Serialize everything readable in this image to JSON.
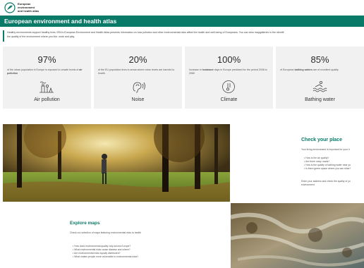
{
  "header": {
    "logo_text_lines": [
      "European",
      "environment",
      "and health atlas"
    ],
    "title": "European environment and health atlas"
  },
  "intro": {
    "line1": "Healthy environments support healthy lives. EEA's European Environment and Health Atlas presents information on how pollution and other environmental risks affect the health and well-being of Europeans. You can view mapgalleries in the identifi",
    "line2": "the quality of the environment where you live, work and play."
  },
  "stats": [
    {
      "percent": "97%",
      "description_pre": "of the urban population in Europe is exposed to unsafe levels of ",
      "description_bold": "air pollution",
      "description_post": "",
      "label": "Air pollution",
      "icon": "air-pollution-icon"
    },
    {
      "percent": "20%",
      "description_pre": "of the EU population lives in areas where noise levels are harmful to health",
      "description_bold": "",
      "description_post": "",
      "label": "Noise",
      "icon": "noise-ear-icon"
    },
    {
      "percent": "100%",
      "description_pre": "Increase in ",
      "description_bold": "heatwave",
      "description_post": " days in Europe predicted for the period 2036 to 2080",
      "label": "Climate",
      "icon": "thermometer-icon"
    },
    {
      "percent": "85%",
      "description_pre": "of European ",
      "description_bold": "bathing waters",
      "description_post": " are of excellent quality",
      "label": "Bathing water",
      "icon": "bathing-water-icon"
    }
  ],
  "check_place": {
    "title": "Check your place",
    "intro": "Your living environment is important for your h",
    "questions": [
      "How is the air quality?",
      "Are there noisy roads?",
      "How is the quality of bathing water near yo",
      "Is there green space where you can relax?"
    ],
    "outro_line1": "Enter your address and check the quality of yo",
    "outro_line2": "environment"
  },
  "explore": {
    "title": "Explore maps",
    "intro": "Check our selection of maps featuring environmental risks to health",
    "questions": [
      "How does environmental quality vary across Europe?",
      "What environmental risks cause disease and where?",
      "Are environmental risks equally distributed?",
      "What makes people more vulnerable to environmental risks?"
    ]
  },
  "colors": {
    "brand": "#0a7a68",
    "card_bg": "#f1f1f1"
  }
}
